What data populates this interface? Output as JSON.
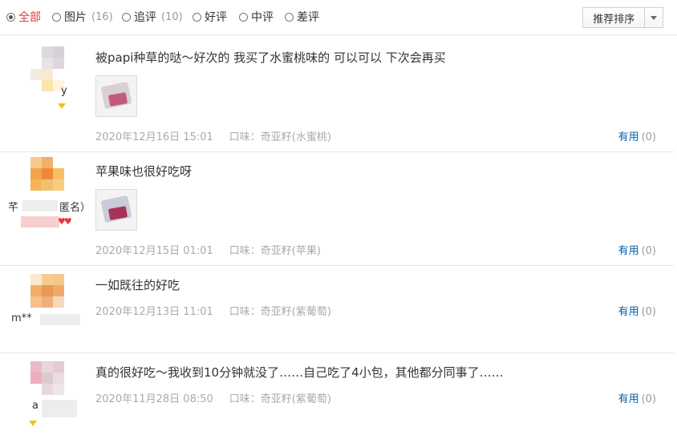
{
  "filters": [
    {
      "label": "全部",
      "count": "",
      "checked": true
    },
    {
      "label": "图片",
      "count": "(16)",
      "checked": false
    },
    {
      "label": "追评",
      "count": "(10)",
      "checked": false
    },
    {
      "label": "好评",
      "count": "",
      "checked": false
    },
    {
      "label": "中评",
      "count": "",
      "checked": false
    },
    {
      "label": "差评",
      "count": "",
      "checked": false
    }
  ],
  "sort": {
    "label": "推荐排序"
  },
  "reviews": [
    {
      "username": "y",
      "text": "被papi种草的哒～好次的 我买了水蜜桃味的 可以可以 下次会再买",
      "date": "2020年12月16日 15:01",
      "flavor": "口味：奇亚籽(水蜜桃)",
      "useful_label": "有用",
      "useful_count": "(0)"
    },
    {
      "username": "芊",
      "username_suffix": "匿名）",
      "text": "苹果味也很好吃呀",
      "date": "2020年12月15日 01:01",
      "flavor": "口味：奇亚籽(苹果)",
      "useful_label": "有用",
      "useful_count": "(0)"
    },
    {
      "username": "m**",
      "text": "一如既往的好吃",
      "date": "2020年12月13日 11:01",
      "flavor": "口味：奇亚籽(紫葡萄)",
      "useful_label": "有用",
      "useful_count": "(0)"
    },
    {
      "username": "a",
      "text": "真的很好吃～我收到10分钟就没了……自己吃了4小包，其他都分同事了……",
      "date": "2020年11月28日 08:50",
      "flavor": "口味：奇亚籽(紫葡萄)",
      "useful_label": "有用",
      "useful_count": "(0)"
    }
  ],
  "colors": {
    "accent": "#e4393c",
    "link": "#005ea7",
    "meta": "#aaaaaa"
  }
}
